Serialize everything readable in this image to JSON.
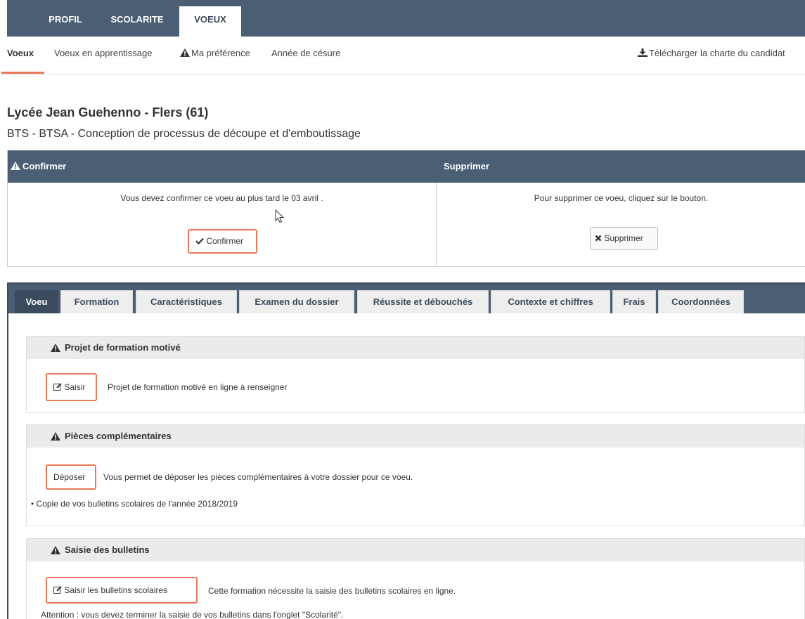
{
  "top_tabs": [
    "PROFIL",
    "SCOLARITE",
    "VOEUX"
  ],
  "sub_nav": {
    "voeux": "Voeux",
    "apprentissage": "Voeux en apprentissage",
    "preference": "Ma préférence",
    "cesure": "Année de césure",
    "charte": "Télécharger la charte du candidat"
  },
  "school": "Lycée Jean Guehenno - Flers (61)",
  "formation": "BTS - BTSA - Conception de processus de découpe et d'emboutissage",
  "confirm": {
    "head": "Confirmer",
    "text": "Vous devez confirmer ce voeu au plus tard le 03 avril .",
    "button": "Confirmer"
  },
  "delete": {
    "head": "Supprimer",
    "text": "Pour supprimer ce voeu, cliquez sur le bouton.",
    "button": "Supprimer"
  },
  "panel_tabs": [
    "Voeu",
    "Formation",
    "Caractéristiques",
    "Examen du dossier",
    "Réussite et débouchés",
    "Contexte et chiffres",
    "Frais",
    "Coordonnées"
  ],
  "sections": {
    "projet": {
      "title": "Projet de formation motivé",
      "button": "Saisir",
      "text": "Projet de formation motivé en ligne à renseigner"
    },
    "pieces": {
      "title": "Pièces complémentaires",
      "button": "Déposer",
      "text": "Vous permet de déposer les pièces complémentaires à votre dossier pour ce voeu.",
      "bullet": "• Copie de vos bulletins scolaires de l'année 2018/2019"
    },
    "bulletins": {
      "title": "Saisie des bulletins",
      "button": "Saisir les bulletins scolaires",
      "text": "Cette formation nécessite la saisie des bulletins scolaires en ligne.",
      "note": "Attention : vous devez terminer la saisie de vos bulletins dans l'onglet \"Scolarité\"."
    }
  },
  "colors": {
    "nav": "#4a5e74",
    "accent": "#e8785a",
    "section_head": "#ebebeb"
  }
}
